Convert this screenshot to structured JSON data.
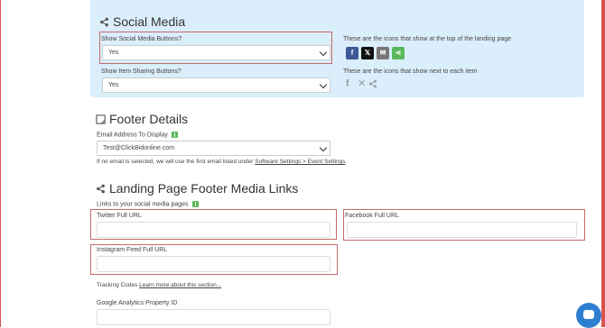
{
  "social_media": {
    "heading": "Social Media",
    "show_buttons_label": "Show Social Media Buttons?",
    "show_buttons_value": "Yes",
    "show_buttons_note": "These are the icons that show at the top of the landing page",
    "show_sharing_label": "Show Item Sharing Buttons?",
    "show_sharing_value": "Yes",
    "show_sharing_note": "These are the icons that show next to each item",
    "button_icons": [
      {
        "glyph": "f",
        "icon": "facebook-icon",
        "color": "#3b5998"
      },
      {
        "glyph": "𝕏",
        "icon": "x-icon",
        "color": "#111111"
      },
      {
        "glyph": "✉",
        "icon": "email-icon",
        "color": "#777777"
      },
      {
        "glyph": "⋖",
        "icon": "share-icon",
        "color": "#5cb85c"
      }
    ]
  },
  "footer_details": {
    "heading": "Footer Details",
    "email_label": "Email Address To Display",
    "email_value": "Test@ClickBidonline.com",
    "help_prefix": "If no email is selected, we will use the first email listed under",
    "help_link": "Software Settings > Event Settings"
  },
  "footer_media": {
    "heading": "Landing Page Footer Media Links",
    "links_label": "Links to your social media pages",
    "twitter_label": "Twitter Full URL",
    "facebook_label": "Facebook Full URL",
    "instagram_label": "Instagram Feed Full URL",
    "tracking_prefix": "Tracking Codes",
    "tracking_link": "Learn more about this section...",
    "ga_label": "Google Analytics Property ID"
  },
  "colors": {
    "panel": "#dbeefb",
    "accent_red": "#c46a6a",
    "chat": "#2f7fd1"
  }
}
